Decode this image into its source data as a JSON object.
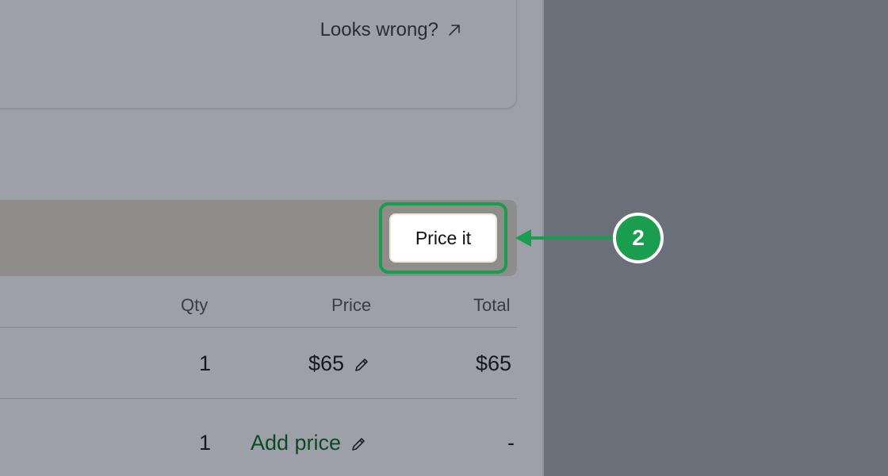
{
  "card": {
    "link_label": "Looks wrong?",
    "link_icon": "arrow-up-right-icon"
  },
  "banner": {
    "button_label": "Price it",
    "highlight_color": "#1a9d4f"
  },
  "table": {
    "headers": {
      "qty": "Qty",
      "price": "Price",
      "total": "Total"
    },
    "rows": [
      {
        "qty": "1",
        "price": "$65",
        "total": "$65"
      },
      {
        "qty": "1",
        "price": "Add price",
        "total": "-"
      }
    ]
  },
  "annotation": {
    "step_number": "2",
    "color": "#1a9d4f"
  }
}
